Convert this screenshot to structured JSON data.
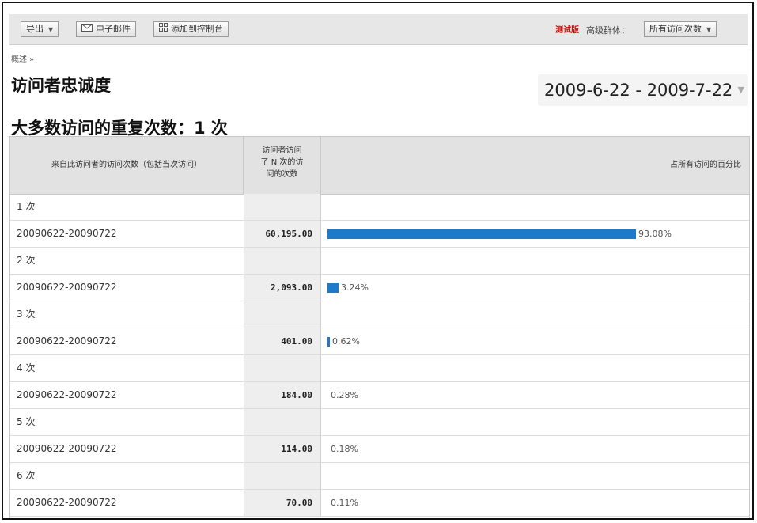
{
  "toolbar": {
    "export_label": "导出",
    "email_label": "电子邮件",
    "dashboard_label": "添加到控制台",
    "beta_label": "测试版",
    "segment_label": "高级群体：",
    "segment_value": "所有访问次数"
  },
  "breadcrumb": "概述 »",
  "page_title": "访问者忠诚度",
  "date_range": "2009-6-22 - 2009-7-22",
  "headline": "大多数访问的重复次数：1 次",
  "table": {
    "col1_header": "来自此访问者的访问次数（包括当次访问）",
    "col2_header_lines": [
      "访问者访问",
      "了 N 次的访",
      "问的次数"
    ],
    "col3_header": "占所有访问的百分比",
    "rows": [
      {
        "kind": "group",
        "label": "1 次"
      },
      {
        "kind": "data",
        "date": "20090622-20090722",
        "value": "60,195.00",
        "percent": "93.08%",
        "ratio": 0.9308
      },
      {
        "kind": "group",
        "label": "2 次"
      },
      {
        "kind": "data",
        "date": "20090622-20090722",
        "value": "2,093.00",
        "percent": "3.24%",
        "ratio": 0.0324
      },
      {
        "kind": "group",
        "label": "3 次"
      },
      {
        "kind": "data",
        "date": "20090622-20090722",
        "value": "401.00",
        "percent": "0.62%",
        "ratio": 0.0062
      },
      {
        "kind": "group",
        "label": "4 次"
      },
      {
        "kind": "data",
        "date": "20090622-20090722",
        "value": "184.00",
        "percent": "0.28%",
        "ratio": 0.0028
      },
      {
        "kind": "group",
        "label": "5 次"
      },
      {
        "kind": "data",
        "date": "20090622-20090722",
        "value": "114.00",
        "percent": "0.18%",
        "ratio": 0.0018
      },
      {
        "kind": "group",
        "label": "6 次"
      },
      {
        "kind": "data",
        "date": "20090622-20090722",
        "value": "70.00",
        "percent": "0.11%",
        "ratio": 0.0011
      }
    ]
  },
  "colors": {
    "bar": "#1e79c9",
    "beta": "#cc0000"
  },
  "icons": {
    "email": "envelope-icon",
    "dashboard": "grid-icon",
    "dropdown": "chevron-down-icon"
  }
}
